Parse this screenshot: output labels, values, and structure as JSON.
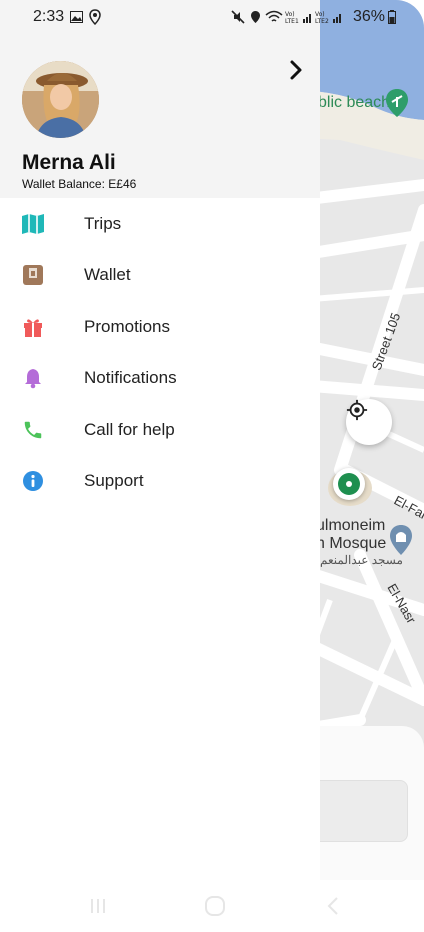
{
  "status_bar": {
    "time": "2:33",
    "battery": "36%",
    "icons": [
      "gallery-icon",
      "location-pin-icon",
      "mute-icon",
      "location-icon",
      "wifi-icon",
      "signal-icon",
      "battery-icon"
    ]
  },
  "map": {
    "beach_label": "blic beach",
    "mosque_line1": "ulmoneim",
    "mosque_line2": "h Mosque",
    "mosque_arabic": "مسجد عبدالمنعم",
    "street_label": "Street 105",
    "elfar_label": "El-Far",
    "elnasr_label": "El-Nasr",
    "colors": {
      "water": "#8fb0e0",
      "land": "#e8e8e8",
      "road": "#ffffff",
      "park": "#d7e4cf"
    }
  },
  "drawer": {
    "user_name": "Merna Ali",
    "wallet_balance": "Wallet Balance: E£46",
    "items": [
      {
        "label": "Trips",
        "icon": "map-icon",
        "color": "#1fb8b8"
      },
      {
        "label": "Wallet",
        "icon": "wallet-icon",
        "color": "#a0785a"
      },
      {
        "label": "Promotions",
        "icon": "gift-icon",
        "color": "#f05a5a"
      },
      {
        "label": "Notifications",
        "icon": "bell-icon",
        "color": "#b46cd8"
      },
      {
        "label": "Call for help",
        "icon": "phone-icon",
        "color": "#4cc35a"
      },
      {
        "label": "Support",
        "icon": "info-icon",
        "color": "#2f8fe0"
      }
    ]
  },
  "nav_bar": {
    "buttons": [
      "recents-icon",
      "home-icon",
      "back-icon"
    ]
  }
}
